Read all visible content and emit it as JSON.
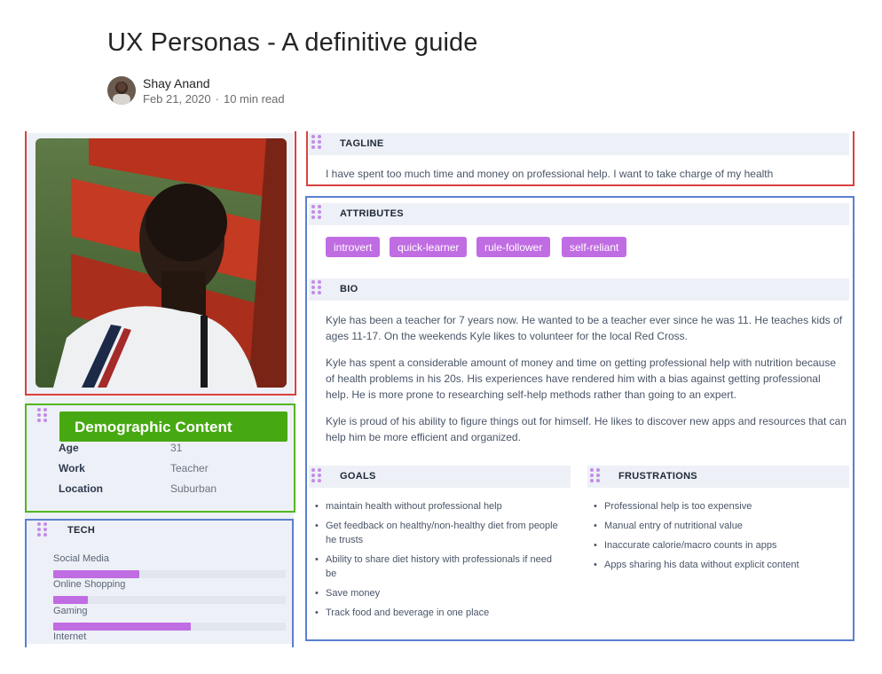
{
  "article": {
    "title": "UX Personas - A definitive guide",
    "author": "Shay Anand",
    "date": "Feb 21, 2020",
    "separator": "·",
    "read_time": "10 min read"
  },
  "persona": {
    "demographic_title": "Demographic Content",
    "demographics": [
      {
        "label": "Age",
        "value": "31"
      },
      {
        "label": "Work",
        "value": "Teacher"
      },
      {
        "label": "Location",
        "value": "Suburban"
      }
    ],
    "tech": {
      "title": "TECH",
      "items": [
        {
          "label": "Social Media",
          "level": 0.37
        },
        {
          "label": "Online Shopping",
          "level": 0.15
        },
        {
          "label": "Gaming",
          "level": 0.59
        },
        {
          "label": "Internet",
          "level": 0.0
        }
      ]
    },
    "tagline": {
      "title": "TAGLINE",
      "text": "I have spent too much time and money on professional help. I want to take charge of my health"
    },
    "attributes": {
      "title": "ATTRIBUTES",
      "tags": [
        "introvert",
        "quick-learner",
        "rule-follower",
        "self-reliant"
      ]
    },
    "bio": {
      "title": "BIO",
      "paragraphs": [
        "Kyle has been a teacher for 7 years now. He wanted to be a teacher ever since he was 11. He teaches kids of ages 11-17. On the weekends Kyle likes to volunteer for the local Red Cross.",
        "Kyle has spent a considerable amount of money and time on getting professional help with nutrition because of health problems in his 20s. His experiences have rendered him with a bias against getting professional help. He is more prone to researching self-help methods rather than going to an expert.",
        "Kyle is proud of his ability to figure things out for himself. He likes to discover new apps and resources that can help him be more efficient and organized."
      ]
    },
    "goals": {
      "title": "GOALS",
      "items": [
        "maintain health without professional help",
        "Get feedback on healthy/non-healthy diet from people he trusts",
        "Ability to share diet history with professionals if need be",
        "Save money",
        "Track food and beverage in one place"
      ]
    },
    "frustrations": {
      "title": "FRUSTRATIONS",
      "items": [
        "Professional help is too expensive",
        "Manual entry of nutritional value",
        "Inaccurate calorie/macro counts in apps",
        "Apps sharing his data without explicit content"
      ]
    }
  },
  "colors": {
    "accent_purple": "#c06ce3",
    "box_red": "#d9423f",
    "box_green": "#52b51f",
    "box_blue": "#5b7fd1",
    "banner_green": "#47a912"
  }
}
